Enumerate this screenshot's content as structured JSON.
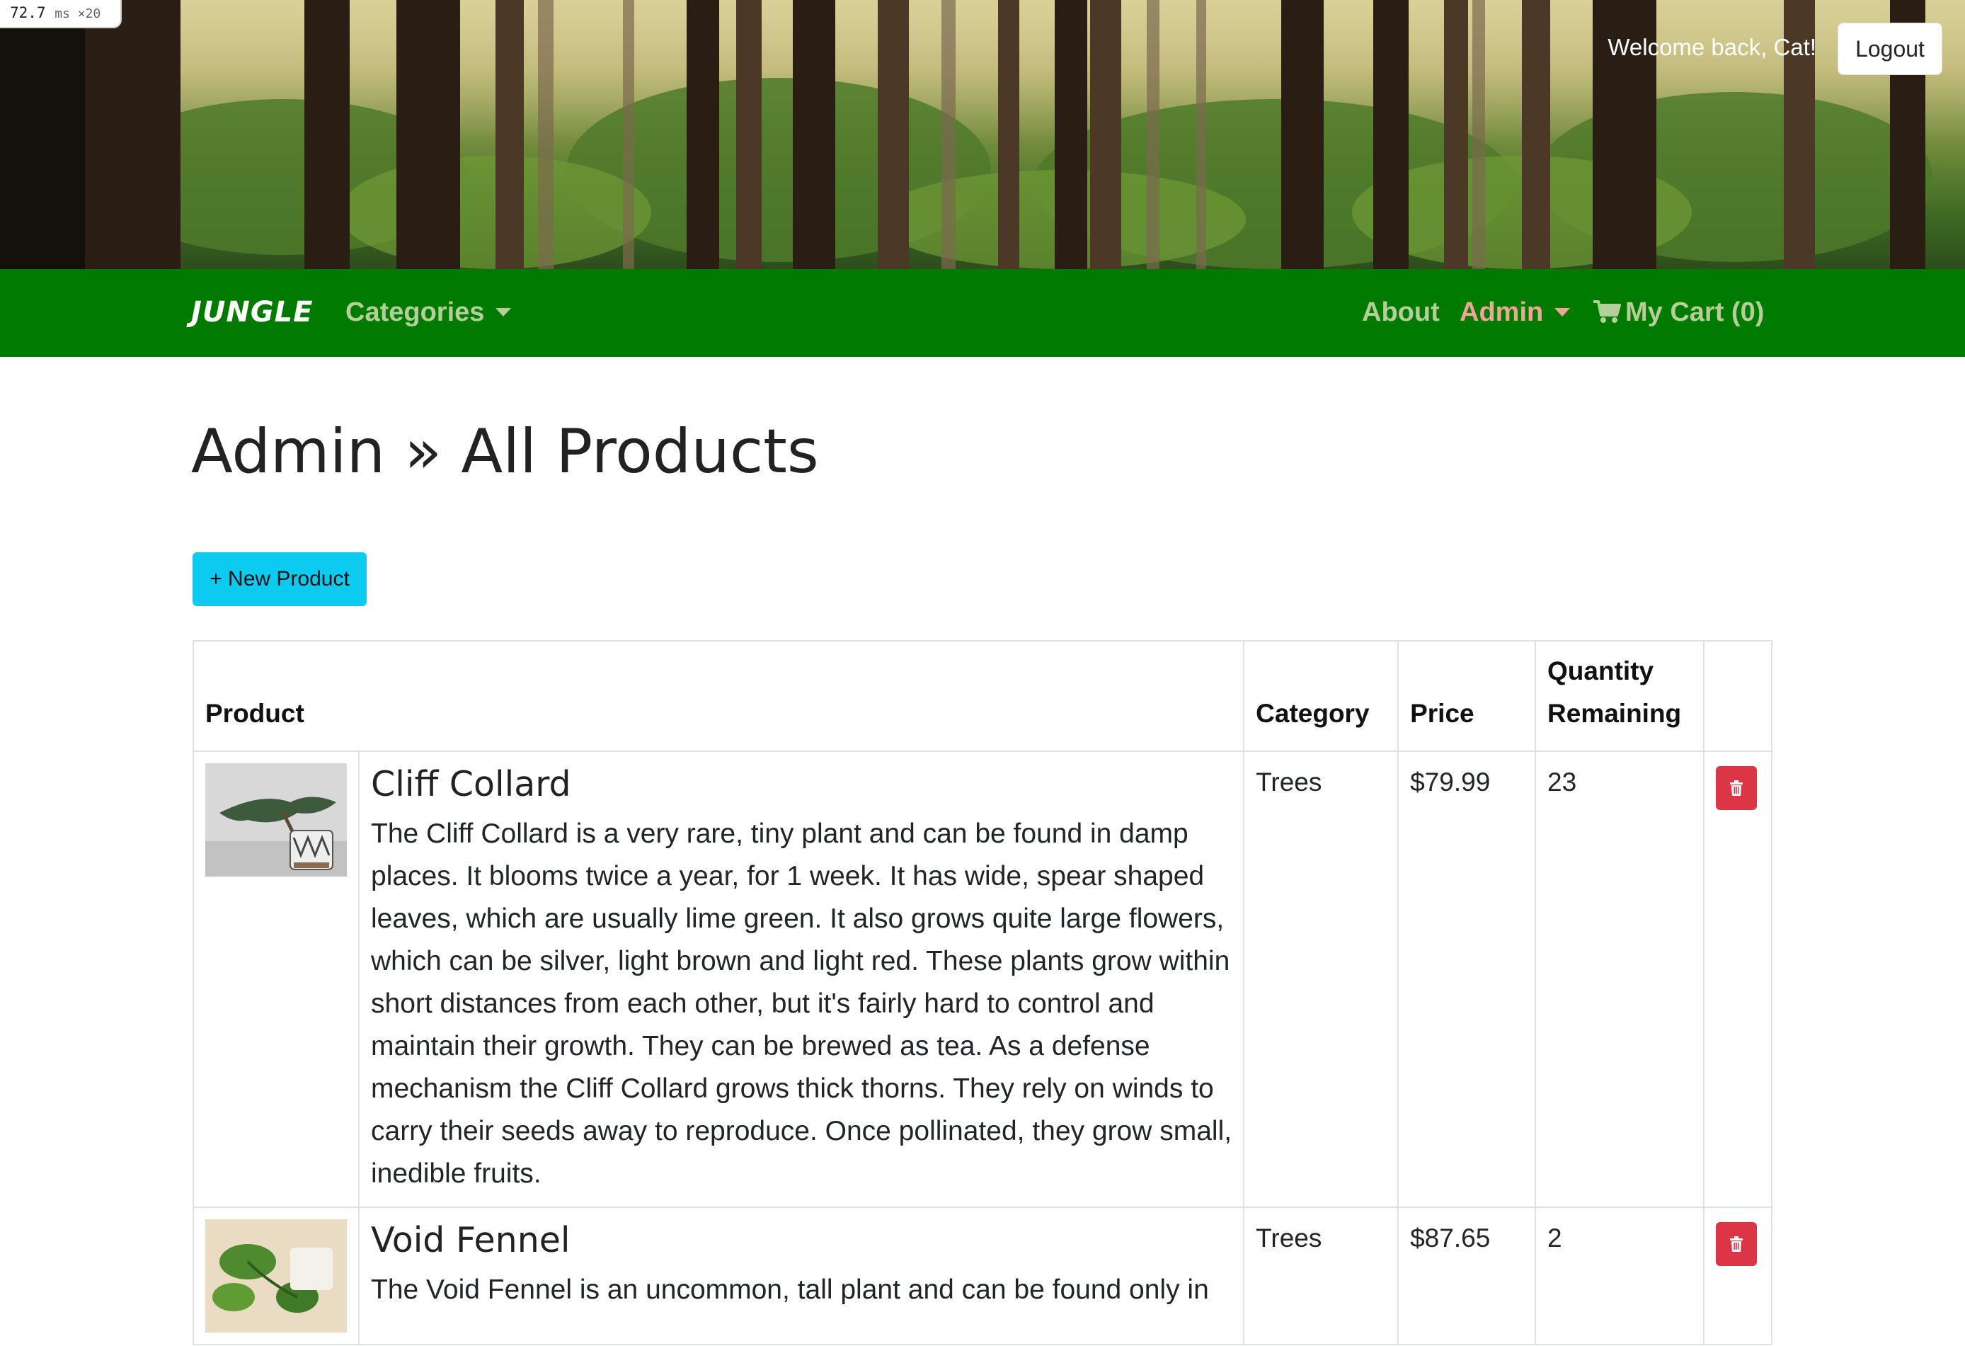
{
  "perf": {
    "value": "72.7",
    "unit": "ms ×20"
  },
  "header": {
    "welcome": "Welcome back, Cat!",
    "logout_label": "Logout"
  },
  "navbar": {
    "brand": "JUNGLE",
    "categories": "Categories",
    "about": "About",
    "admin": "Admin",
    "cart": "My Cart (0)"
  },
  "page": {
    "title": "Admin » All Products",
    "new_product_label": "+ New Product"
  },
  "table": {
    "headers": {
      "product": "Product",
      "category": "Category",
      "price": "Price",
      "quantity": "Quantity Remaining"
    },
    "rows": [
      {
        "name": "Cliff Collard",
        "description": "The Cliff Collard is a very rare, tiny plant and can be found in damp places. It blooms twice a year, for 1 week. It has wide, spear shaped leaves, which are usually lime green. It also grows quite large flowers, which can be silver, light brown and light red. These plants grow within short distances from each other, but it's fairly hard to control and maintain their growth. They can be brewed as tea. As a defense mechanism the Cliff Collard grows thick thorns. They rely on winds to carry their seeds away to reproduce. Once pollinated, they grow small, inedible fruits.",
        "category": "Trees",
        "price": "$79.99",
        "quantity": "23"
      },
      {
        "name": "Void Fennel",
        "description": "The Void Fennel is an uncommon, tall plant and can be found only in",
        "category": "Trees",
        "price": "$87.65",
        "quantity": "2"
      }
    ]
  },
  "colors": {
    "navbar": "#007b00",
    "new_button": "#0dcaf0",
    "delete_button": "#dc3545",
    "admin_link": "#f4a39a",
    "nav_link": "#b5cf9a"
  }
}
